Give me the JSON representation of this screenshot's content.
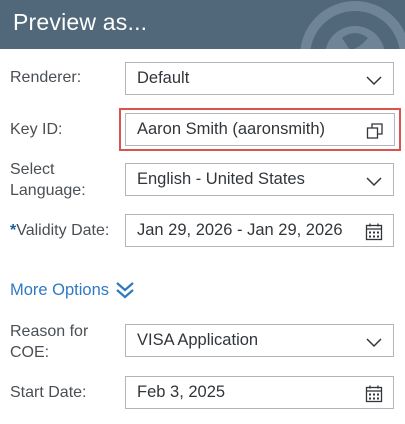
{
  "header": {
    "title": "Preview as..."
  },
  "renderer": {
    "label": "Renderer:",
    "value": "Default",
    "icon": "chevron-down-icon"
  },
  "key_id": {
    "label": "Key ID:",
    "value": "Aaron Smith (aaronsmith)",
    "icon": "copy-icon"
  },
  "language": {
    "label_line1": "Select",
    "label_line2": "Language:",
    "value": "English - United States",
    "icon": "chevron-down-icon"
  },
  "validity": {
    "required_mark": "*",
    "label": "Validity Date:",
    "value": "Jan 29, 2026 - Jan 29, 2026",
    "icon": "calendar-icon"
  },
  "more_options": {
    "label": "More Options",
    "icon": "double-chevron-down-icon"
  },
  "reason": {
    "label_line1": "Reason for",
    "label_line2": "COE:",
    "value": "VISA Application",
    "icon": "chevron-down-icon"
  },
  "start_date": {
    "label": "Start Date:",
    "value": "Feb 3, 2025",
    "icon": "calendar-icon"
  },
  "colors": {
    "header_bg": "#51687a",
    "link": "#2f79c4",
    "highlight": "#d9534f",
    "required": "#1b5fa8"
  }
}
